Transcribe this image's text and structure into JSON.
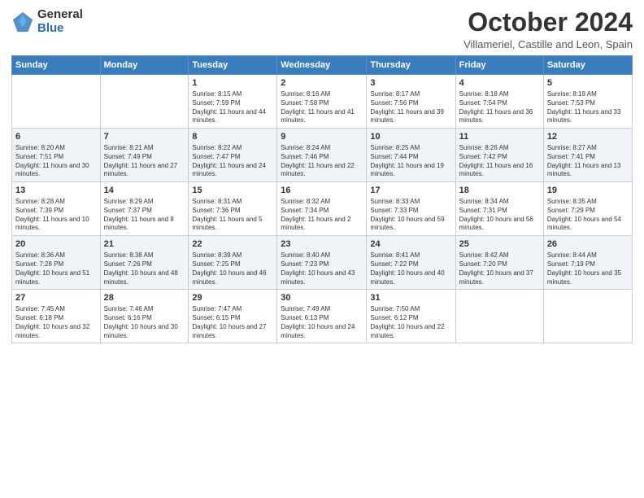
{
  "logo": {
    "general": "General",
    "blue": "Blue"
  },
  "header": {
    "month": "October 2024",
    "location": "Villameriel, Castille and Leon, Spain"
  },
  "weekdays": [
    "Sunday",
    "Monday",
    "Tuesday",
    "Wednesday",
    "Thursday",
    "Friday",
    "Saturday"
  ],
  "weeks": [
    [
      {
        "day": "",
        "info": ""
      },
      {
        "day": "",
        "info": ""
      },
      {
        "day": "1",
        "info": "Sunrise: 8:15 AM\nSunset: 7:59 PM\nDaylight: 11 hours and 44 minutes."
      },
      {
        "day": "2",
        "info": "Sunrise: 8:16 AM\nSunset: 7:58 PM\nDaylight: 11 hours and 41 minutes."
      },
      {
        "day": "3",
        "info": "Sunrise: 8:17 AM\nSunset: 7:56 PM\nDaylight: 11 hours and 39 minutes."
      },
      {
        "day": "4",
        "info": "Sunrise: 8:18 AM\nSunset: 7:54 PM\nDaylight: 11 hours and 36 minutes."
      },
      {
        "day": "5",
        "info": "Sunrise: 8:19 AM\nSunset: 7:53 PM\nDaylight: 11 hours and 33 minutes."
      }
    ],
    [
      {
        "day": "6",
        "info": "Sunrise: 8:20 AM\nSunset: 7:51 PM\nDaylight: 11 hours and 30 minutes."
      },
      {
        "day": "7",
        "info": "Sunrise: 8:21 AM\nSunset: 7:49 PM\nDaylight: 11 hours and 27 minutes."
      },
      {
        "day": "8",
        "info": "Sunrise: 8:22 AM\nSunset: 7:47 PM\nDaylight: 11 hours and 24 minutes."
      },
      {
        "day": "9",
        "info": "Sunrise: 8:24 AM\nSunset: 7:46 PM\nDaylight: 11 hours and 22 minutes."
      },
      {
        "day": "10",
        "info": "Sunrise: 8:25 AM\nSunset: 7:44 PM\nDaylight: 11 hours and 19 minutes."
      },
      {
        "day": "11",
        "info": "Sunrise: 8:26 AM\nSunset: 7:42 PM\nDaylight: 11 hours and 16 minutes."
      },
      {
        "day": "12",
        "info": "Sunrise: 8:27 AM\nSunset: 7:41 PM\nDaylight: 11 hours and 13 minutes."
      }
    ],
    [
      {
        "day": "13",
        "info": "Sunrise: 8:28 AM\nSunset: 7:39 PM\nDaylight: 11 hours and 10 minutes."
      },
      {
        "day": "14",
        "info": "Sunrise: 8:29 AM\nSunset: 7:37 PM\nDaylight: 11 hours and 8 minutes."
      },
      {
        "day": "15",
        "info": "Sunrise: 8:31 AM\nSunset: 7:36 PM\nDaylight: 11 hours and 5 minutes."
      },
      {
        "day": "16",
        "info": "Sunrise: 8:32 AM\nSunset: 7:34 PM\nDaylight: 11 hours and 2 minutes."
      },
      {
        "day": "17",
        "info": "Sunrise: 8:33 AM\nSunset: 7:33 PM\nDaylight: 10 hours and 59 minutes."
      },
      {
        "day": "18",
        "info": "Sunrise: 8:34 AM\nSunset: 7:31 PM\nDaylight: 10 hours and 56 minutes."
      },
      {
        "day": "19",
        "info": "Sunrise: 8:35 AM\nSunset: 7:29 PM\nDaylight: 10 hours and 54 minutes."
      }
    ],
    [
      {
        "day": "20",
        "info": "Sunrise: 8:36 AM\nSunset: 7:28 PM\nDaylight: 10 hours and 51 minutes."
      },
      {
        "day": "21",
        "info": "Sunrise: 8:38 AM\nSunset: 7:26 PM\nDaylight: 10 hours and 48 minutes."
      },
      {
        "day": "22",
        "info": "Sunrise: 8:39 AM\nSunset: 7:25 PM\nDaylight: 10 hours and 46 minutes."
      },
      {
        "day": "23",
        "info": "Sunrise: 8:40 AM\nSunset: 7:23 PM\nDaylight: 10 hours and 43 minutes."
      },
      {
        "day": "24",
        "info": "Sunrise: 8:41 AM\nSunset: 7:22 PM\nDaylight: 10 hours and 40 minutes."
      },
      {
        "day": "25",
        "info": "Sunrise: 8:42 AM\nSunset: 7:20 PM\nDaylight: 10 hours and 37 minutes."
      },
      {
        "day": "26",
        "info": "Sunrise: 8:44 AM\nSunset: 7:19 PM\nDaylight: 10 hours and 35 minutes."
      }
    ],
    [
      {
        "day": "27",
        "info": "Sunrise: 7:45 AM\nSunset: 6:18 PM\nDaylight: 10 hours and 32 minutes."
      },
      {
        "day": "28",
        "info": "Sunrise: 7:46 AM\nSunset: 6:16 PM\nDaylight: 10 hours and 30 minutes."
      },
      {
        "day": "29",
        "info": "Sunrise: 7:47 AM\nSunset: 6:15 PM\nDaylight: 10 hours and 27 minutes."
      },
      {
        "day": "30",
        "info": "Sunrise: 7:49 AM\nSunset: 6:13 PM\nDaylight: 10 hours and 24 minutes."
      },
      {
        "day": "31",
        "info": "Sunrise: 7:50 AM\nSunset: 6:12 PM\nDaylight: 10 hours and 22 minutes."
      },
      {
        "day": "",
        "info": ""
      },
      {
        "day": "",
        "info": ""
      }
    ]
  ]
}
